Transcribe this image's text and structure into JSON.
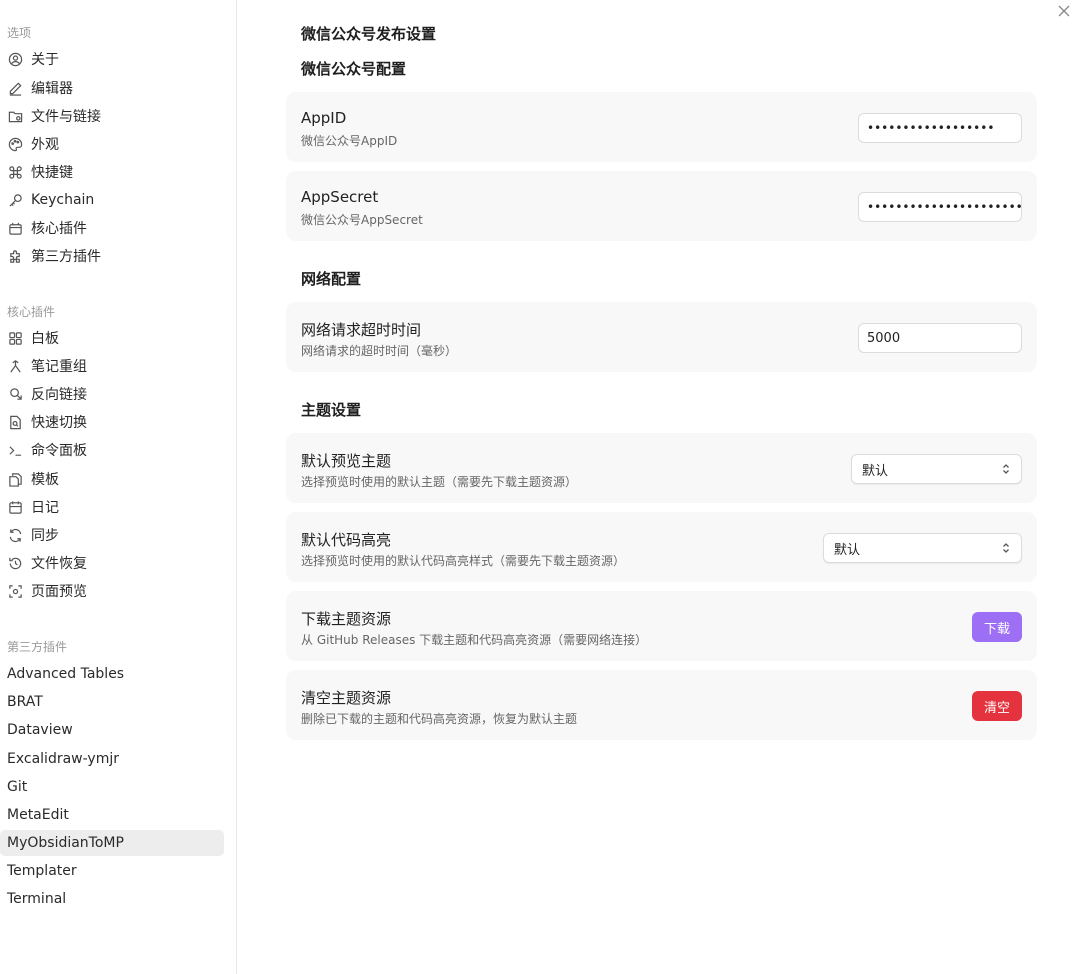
{
  "sidebar": {
    "options_title": "选项",
    "options": [
      {
        "label": "关于",
        "icon": "user-circle-icon"
      },
      {
        "label": "编辑器",
        "icon": "pencil-icon"
      },
      {
        "label": "文件与链接",
        "icon": "folder-icon"
      },
      {
        "label": "外观",
        "icon": "palette-icon"
      },
      {
        "label": "快捷键",
        "icon": "command-icon"
      },
      {
        "label": "Keychain",
        "icon": "key-icon"
      },
      {
        "label": "核心插件",
        "icon": "plugin-icon"
      },
      {
        "label": "第三方插件",
        "icon": "puzzle-icon"
      }
    ],
    "core_title": "核心插件",
    "core": [
      {
        "label": "白板",
        "icon": "grid-icon"
      },
      {
        "label": "笔记重组",
        "icon": "merge-icon"
      },
      {
        "label": "反向链接",
        "icon": "backlink-icon"
      },
      {
        "label": "快速切换",
        "icon": "file-search-icon"
      },
      {
        "label": "命令面板",
        "icon": "terminal-icon"
      },
      {
        "label": "模板",
        "icon": "files-icon"
      },
      {
        "label": "日记",
        "icon": "calendar-icon"
      },
      {
        "label": "同步",
        "icon": "sync-icon"
      },
      {
        "label": "文件恢复",
        "icon": "history-icon"
      },
      {
        "label": "页面预览",
        "icon": "preview-icon"
      }
    ],
    "community_title": "第三方插件",
    "community": [
      {
        "label": "Advanced Tables"
      },
      {
        "label": "BRAT"
      },
      {
        "label": "Dataview"
      },
      {
        "label": "Excalidraw-ymjr"
      },
      {
        "label": "Git"
      },
      {
        "label": "MetaEdit"
      },
      {
        "label": "MyObsidianToMP"
      },
      {
        "label": "Templater"
      },
      {
        "label": "Terminal"
      }
    ],
    "active": "MyObsidianToMP"
  },
  "main": {
    "page_title": "微信公众号发布设置",
    "wechat_section": "微信公众号配置",
    "appid": {
      "name": "AppID",
      "desc": "微信公众号AppID",
      "value": "••••••••••••••••••"
    },
    "appsecret": {
      "name": "AppSecret",
      "desc": "微信公众号AppSecret",
      "value": "••••••••••••••••••••••••••"
    },
    "network_section": "网络配置",
    "timeout": {
      "name": "网络请求超时时间",
      "desc": "网络请求的超时时间（毫秒）",
      "value": "5000"
    },
    "theme_section": "主题设置",
    "preview_theme": {
      "name": "默认预览主题",
      "desc": "选择预览时使用的默认主题（需要先下载主题资源）",
      "value": "默认"
    },
    "code_highlight": {
      "name": "默认代码高亮",
      "desc": "选择预览时使用的默认代码高亮样式（需要先下载主题资源）",
      "value": "默认"
    },
    "download": {
      "name": "下载主题资源",
      "desc": "从 GitHub Releases 下载主题和代码高亮资源（需要网络连接）",
      "button": "下载"
    },
    "clear": {
      "name": "清空主题资源",
      "desc": "删除已下载的主题和代码高亮资源，恢复为默认主题",
      "button": "清空"
    }
  },
  "colors": {
    "download_button": "#9c6ff5",
    "clear_button": "#e5323f"
  }
}
